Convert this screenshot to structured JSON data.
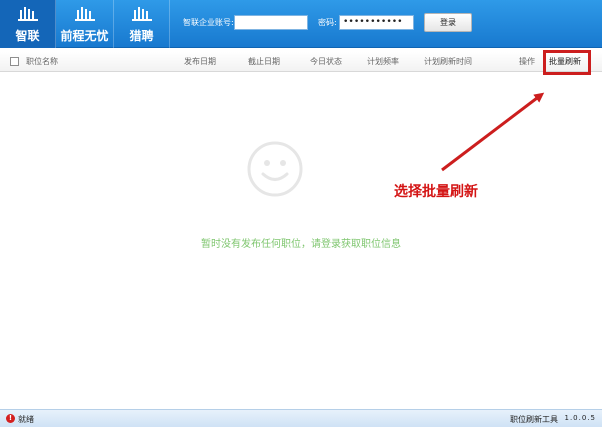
{
  "tabs": [
    {
      "label": "智联",
      "icon": "building-icon",
      "active": true
    },
    {
      "label": "前程无忧",
      "icon": "building-icon",
      "active": false
    },
    {
      "label": "猎聘",
      "icon": "building-icon",
      "active": false
    }
  ],
  "login": {
    "account_label": "智联企业账号:",
    "account_value": "",
    "password_label": "密码:",
    "password_value": "•••••••••••",
    "login_button": "登录"
  },
  "columns": {
    "name": "职位名称",
    "publish_date": "发布日期",
    "end_date": "截止日期",
    "today_status": "今日状态",
    "plan_frequency": "计划频率",
    "plan_refresh_time": "计划刷新时间",
    "operation": "操作",
    "batch_refresh": "批量刷新"
  },
  "annotation": {
    "text": "选择批量刷新",
    "color": "#d41515"
  },
  "empty_state": {
    "icon": "smiley-icon",
    "message": "暂时没有发布任何职位，请登录获取职位信息"
  },
  "status": {
    "icon": "error-icon",
    "icon_glyph": "!",
    "text": "就绪",
    "app_name": "职位刷新工具",
    "version": "1.0.0.5"
  },
  "colors": {
    "header_blue": "#1f86d9",
    "active_tab": "#1466b8",
    "empty_text": "#7fc66f",
    "annotation_red": "#cc1e1e"
  }
}
